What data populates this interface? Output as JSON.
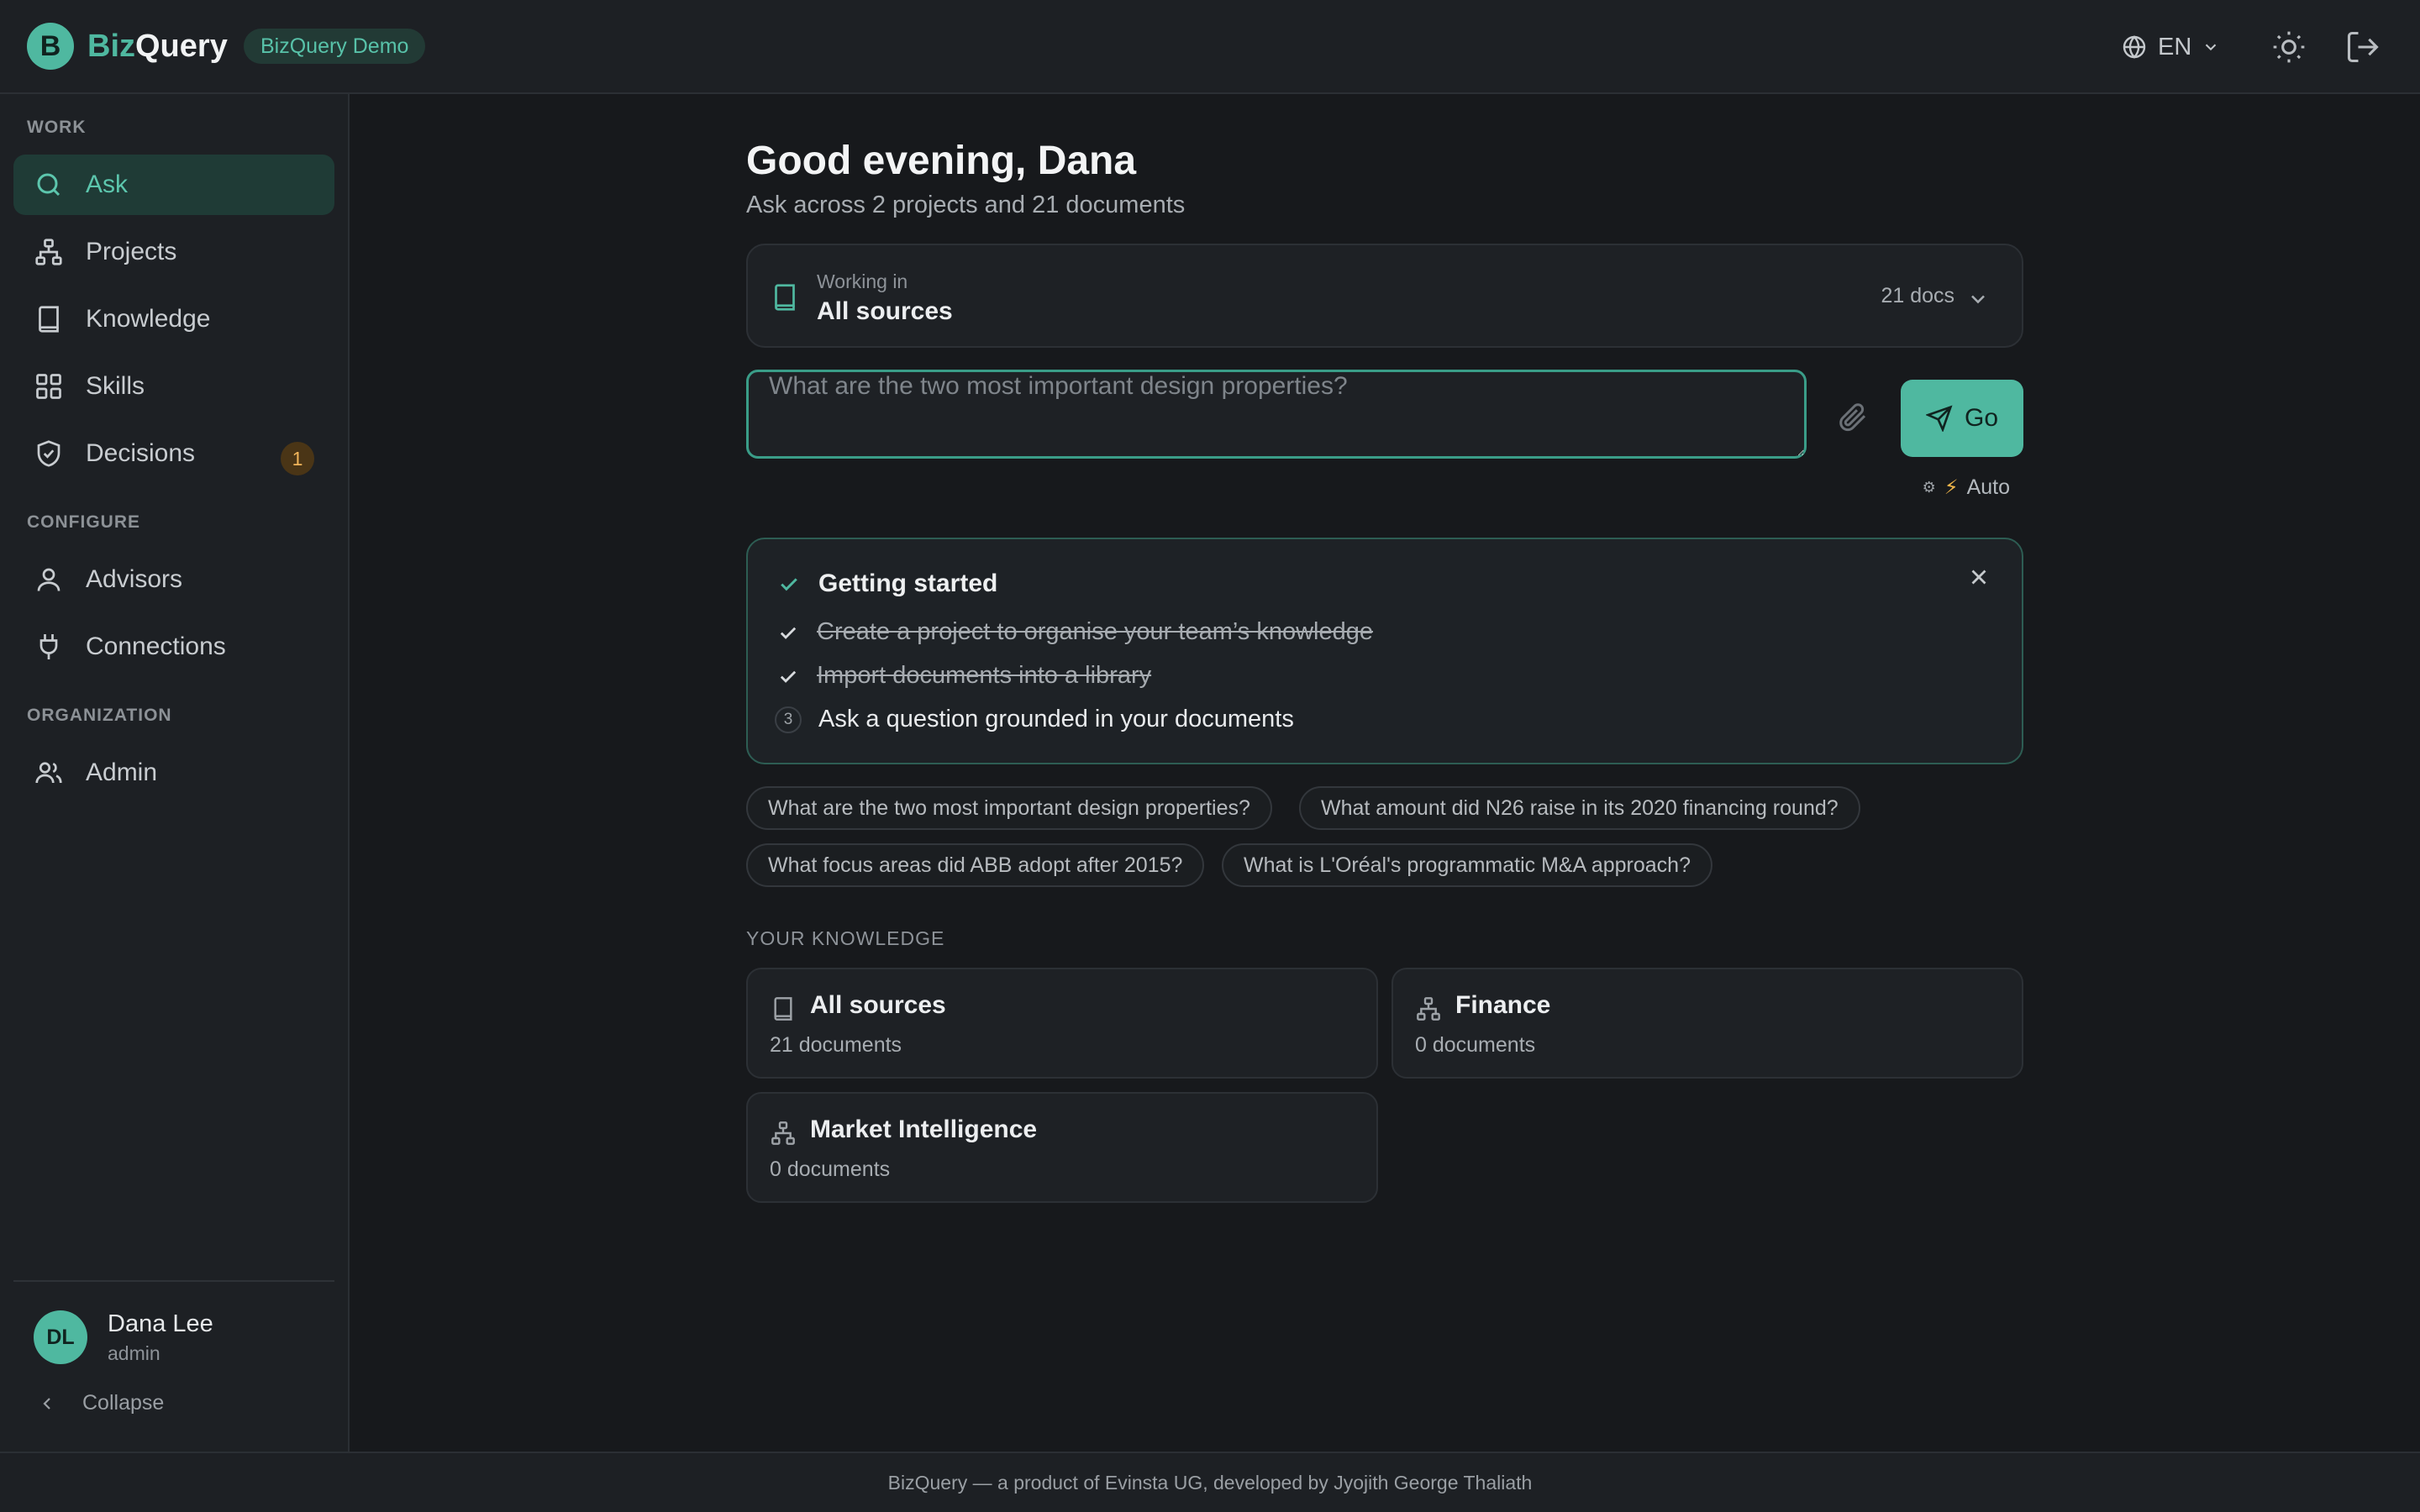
{
  "app": {
    "logo_letter": "B",
    "name_part1": "Biz",
    "name_part2": "Query",
    "demo_badge": "BizQuery Demo",
    "accent_color": "#4fb8a0"
  },
  "topbar": {
    "language": "EN",
    "icons": [
      "globe-icon",
      "chevron-down-icon",
      "sun-icon",
      "logout-icon"
    ]
  },
  "sidebar": {
    "sections": {
      "work": "WORK",
      "configure": "CONFIGURE",
      "organization": "ORGANIZATION"
    },
    "items": [
      {
        "label": "Ask",
        "icon": "search-icon",
        "active": true
      },
      {
        "label": "Projects",
        "icon": "hierarchy-icon"
      },
      {
        "label": "Knowledge",
        "icon": "book-icon"
      },
      {
        "label": "Skills",
        "icon": "grid-icon"
      },
      {
        "label": "Decisions",
        "icon": "shield-check-icon",
        "badge": "1"
      },
      {
        "label": "Advisors",
        "icon": "user-icon"
      },
      {
        "label": "Connections",
        "icon": "plug-icon"
      },
      {
        "label": "Admin",
        "icon": "users-icon"
      }
    ],
    "user": {
      "initials": "DL",
      "name": "Dana Lee",
      "role": "admin"
    },
    "collapse_label": "Collapse"
  },
  "main": {
    "greeting": "Good evening, Dana",
    "subtitle": "Ask across 2 projects and 21 documents",
    "source": {
      "caption": "Working in",
      "value": "All sources",
      "docs": "21 docs"
    },
    "ask": {
      "placeholder": "What are the two most important design properties?",
      "value": "",
      "go_label": "Go",
      "mode_gear": "⚙",
      "mode_bolt": "⚡",
      "mode_label": "Auto"
    },
    "getting_started": {
      "title": "Getting started",
      "steps": [
        {
          "text": "Create a project to organise your team’s knowledge",
          "done": true
        },
        {
          "text": "Import documents into a library",
          "done": true
        },
        {
          "number": "3",
          "text": "Ask a question grounded in your documents",
          "done": false
        }
      ]
    },
    "suggestions": [
      "What are the two most important design properties?",
      "What amount did N26 raise in its 2020 financing round?",
      "What focus areas did ABB adopt after 2015?",
      "What is L'Oréal's programmatic M&A approach?"
    ],
    "knowledge": {
      "label": "YOUR KNOWLEDGE",
      "cards": [
        {
          "name": "All sources",
          "count": "21 documents",
          "icon": "book-icon"
        },
        {
          "name": "Finance",
          "count": "0 documents",
          "icon": "hierarchy-icon"
        },
        {
          "name": "Market Intelligence",
          "count": "0 documents",
          "icon": "hierarchy-icon"
        }
      ]
    }
  },
  "footer": {
    "text": "BizQuery — a product of Evinsta UG, developed by Jyojith George Thaliath"
  }
}
